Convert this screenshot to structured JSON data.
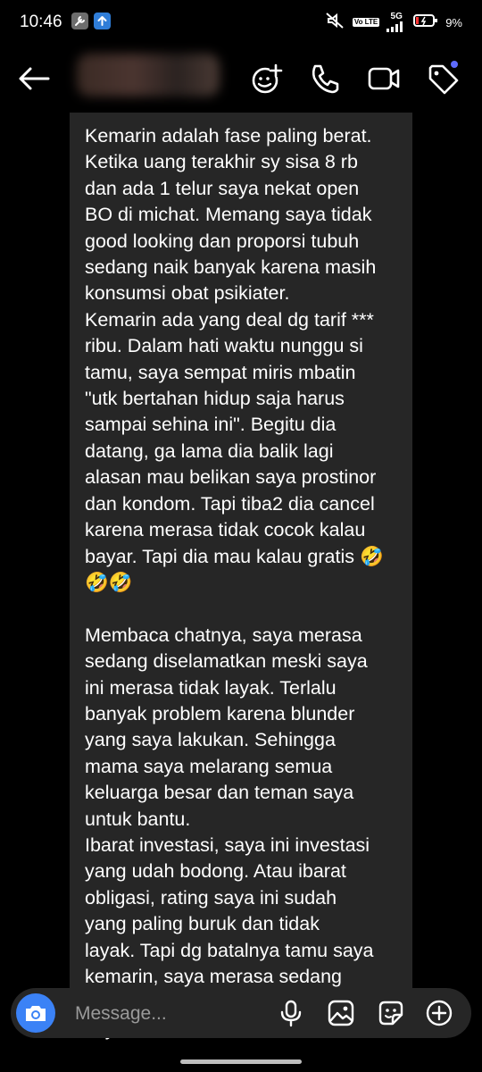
{
  "status_bar": {
    "time": "10:46",
    "network": "5G",
    "volte_badge": "Vo LTE",
    "battery": "9%",
    "icons": [
      "wrench-icon",
      "upload-icon",
      "mute-icon",
      "signal-icon",
      "battery-icon"
    ]
  },
  "header": {
    "icons": [
      "back-arrow-icon",
      "add-to-chat-icon",
      "phone-icon",
      "video-icon",
      "tag-icon"
    ],
    "notification_dot_color": "#5e6bff"
  },
  "message": {
    "text": "Kemarin adalah fase paling berat.\nKetika uang terakhir sy sisa 8 rb\ndan ada 1 telur saya nekat open\nBO di michat. Memang saya tidak\ngood looking dan proporsi tubuh\nsedang naik banyak karena masih\nkonsumsi obat psikiater.\nKemarin ada yang deal dg tarif ***\nribu. Dalam hati waktu nunggu si\ntamu, saya sempat miris mbatin\n\"utk bertahan hidup saja harus\nsampai sehina ini\". Begitu dia\ndatang, ga lama dia balik lagi\nalasan mau belikan saya prostinor\ndan kondom. Tapi tiba2 dia cancel\nkarena merasa tidak cocok kalau\nbayar. Tapi dia mau kalau gratis 🤣\n🤣🤣\n\nMembaca chatnya, saya merasa\nsedang diselamatkan meski saya\nini merasa tidak layak. Terlalu\nbanyak problem karena blunder\nyang saya lakukan. Sehingga\nmama saya melarang semua\nkeluarga besar dan teman saya\nuntuk bantu.\nIbarat investasi, saya ini investasi\nyang udah bodong. Atau ibarat\nobligasi, rating saya ini sudah\nyang paling buruk dan tidak\nlayak. Tapi dg batalnya tamu saya\nkemarin, saya merasa sedang\ndiselamatkan dari jurang yang\nsaya dekati sendiri."
  },
  "composer": {
    "placeholder": "Message...",
    "camera_color": "#3b82f6",
    "icons": [
      "camera-icon",
      "microphone-icon",
      "gallery-icon",
      "sticker-icon",
      "plus-icon"
    ]
  }
}
